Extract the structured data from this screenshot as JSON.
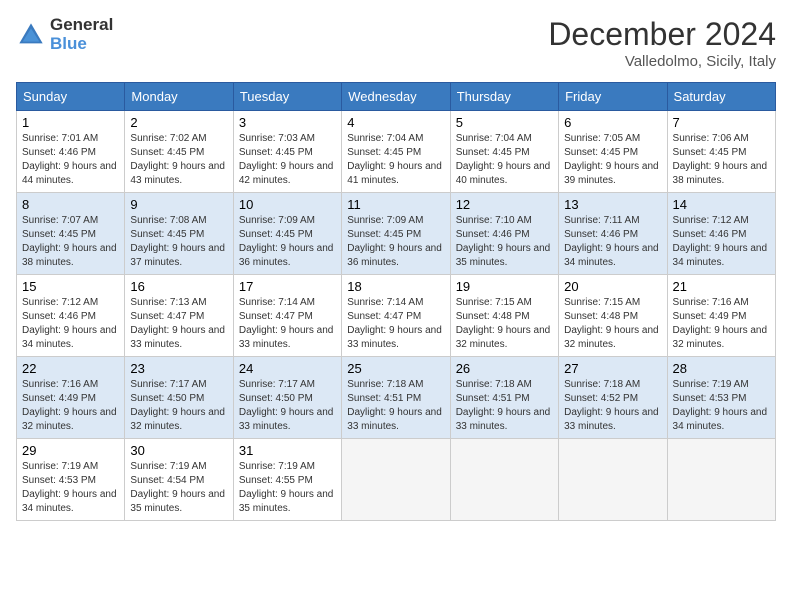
{
  "logo": {
    "general": "General",
    "blue": "Blue"
  },
  "title": {
    "month_year": "December 2024",
    "location": "Valledolmo, Sicily, Italy"
  },
  "headers": [
    "Sunday",
    "Monday",
    "Tuesday",
    "Wednesday",
    "Thursday",
    "Friday",
    "Saturday"
  ],
  "weeks": [
    [
      {
        "day": "1",
        "sunrise": "7:01 AM",
        "sunset": "4:46 PM",
        "daylight": "9 hours and 44 minutes."
      },
      {
        "day": "2",
        "sunrise": "7:02 AM",
        "sunset": "4:45 PM",
        "daylight": "9 hours and 43 minutes."
      },
      {
        "day": "3",
        "sunrise": "7:03 AM",
        "sunset": "4:45 PM",
        "daylight": "9 hours and 42 minutes."
      },
      {
        "day": "4",
        "sunrise": "7:04 AM",
        "sunset": "4:45 PM",
        "daylight": "9 hours and 41 minutes."
      },
      {
        "day": "5",
        "sunrise": "7:04 AM",
        "sunset": "4:45 PM",
        "daylight": "9 hours and 40 minutes."
      },
      {
        "day": "6",
        "sunrise": "7:05 AM",
        "sunset": "4:45 PM",
        "daylight": "9 hours and 39 minutes."
      },
      {
        "day": "7",
        "sunrise": "7:06 AM",
        "sunset": "4:45 PM",
        "daylight": "9 hours and 38 minutes."
      }
    ],
    [
      {
        "day": "8",
        "sunrise": "7:07 AM",
        "sunset": "4:45 PM",
        "daylight": "9 hours and 38 minutes."
      },
      {
        "day": "9",
        "sunrise": "7:08 AM",
        "sunset": "4:45 PM",
        "daylight": "9 hours and 37 minutes."
      },
      {
        "day": "10",
        "sunrise": "7:09 AM",
        "sunset": "4:45 PM",
        "daylight": "9 hours and 36 minutes."
      },
      {
        "day": "11",
        "sunrise": "7:09 AM",
        "sunset": "4:45 PM",
        "daylight": "9 hours and 36 minutes."
      },
      {
        "day": "12",
        "sunrise": "7:10 AM",
        "sunset": "4:46 PM",
        "daylight": "9 hours and 35 minutes."
      },
      {
        "day": "13",
        "sunrise": "7:11 AM",
        "sunset": "4:46 PM",
        "daylight": "9 hours and 34 minutes."
      },
      {
        "day": "14",
        "sunrise": "7:12 AM",
        "sunset": "4:46 PM",
        "daylight": "9 hours and 34 minutes."
      }
    ],
    [
      {
        "day": "15",
        "sunrise": "7:12 AM",
        "sunset": "4:46 PM",
        "daylight": "9 hours and 34 minutes."
      },
      {
        "day": "16",
        "sunrise": "7:13 AM",
        "sunset": "4:47 PM",
        "daylight": "9 hours and 33 minutes."
      },
      {
        "day": "17",
        "sunrise": "7:14 AM",
        "sunset": "4:47 PM",
        "daylight": "9 hours and 33 minutes."
      },
      {
        "day": "18",
        "sunrise": "7:14 AM",
        "sunset": "4:47 PM",
        "daylight": "9 hours and 33 minutes."
      },
      {
        "day": "19",
        "sunrise": "7:15 AM",
        "sunset": "4:48 PM",
        "daylight": "9 hours and 32 minutes."
      },
      {
        "day": "20",
        "sunrise": "7:15 AM",
        "sunset": "4:48 PM",
        "daylight": "9 hours and 32 minutes."
      },
      {
        "day": "21",
        "sunrise": "7:16 AM",
        "sunset": "4:49 PM",
        "daylight": "9 hours and 32 minutes."
      }
    ],
    [
      {
        "day": "22",
        "sunrise": "7:16 AM",
        "sunset": "4:49 PM",
        "daylight": "9 hours and 32 minutes."
      },
      {
        "day": "23",
        "sunrise": "7:17 AM",
        "sunset": "4:50 PM",
        "daylight": "9 hours and 32 minutes."
      },
      {
        "day": "24",
        "sunrise": "7:17 AM",
        "sunset": "4:50 PM",
        "daylight": "9 hours and 33 minutes."
      },
      {
        "day": "25",
        "sunrise": "7:18 AM",
        "sunset": "4:51 PM",
        "daylight": "9 hours and 33 minutes."
      },
      {
        "day": "26",
        "sunrise": "7:18 AM",
        "sunset": "4:51 PM",
        "daylight": "9 hours and 33 minutes."
      },
      {
        "day": "27",
        "sunrise": "7:18 AM",
        "sunset": "4:52 PM",
        "daylight": "9 hours and 33 minutes."
      },
      {
        "day": "28",
        "sunrise": "7:19 AM",
        "sunset": "4:53 PM",
        "daylight": "9 hours and 34 minutes."
      }
    ],
    [
      {
        "day": "29",
        "sunrise": "7:19 AM",
        "sunset": "4:53 PM",
        "daylight": "9 hours and 34 minutes."
      },
      {
        "day": "30",
        "sunrise": "7:19 AM",
        "sunset": "4:54 PM",
        "daylight": "9 hours and 35 minutes."
      },
      {
        "day": "31",
        "sunrise": "7:19 AM",
        "sunset": "4:55 PM",
        "daylight": "9 hours and 35 minutes."
      },
      null,
      null,
      null,
      null
    ]
  ]
}
